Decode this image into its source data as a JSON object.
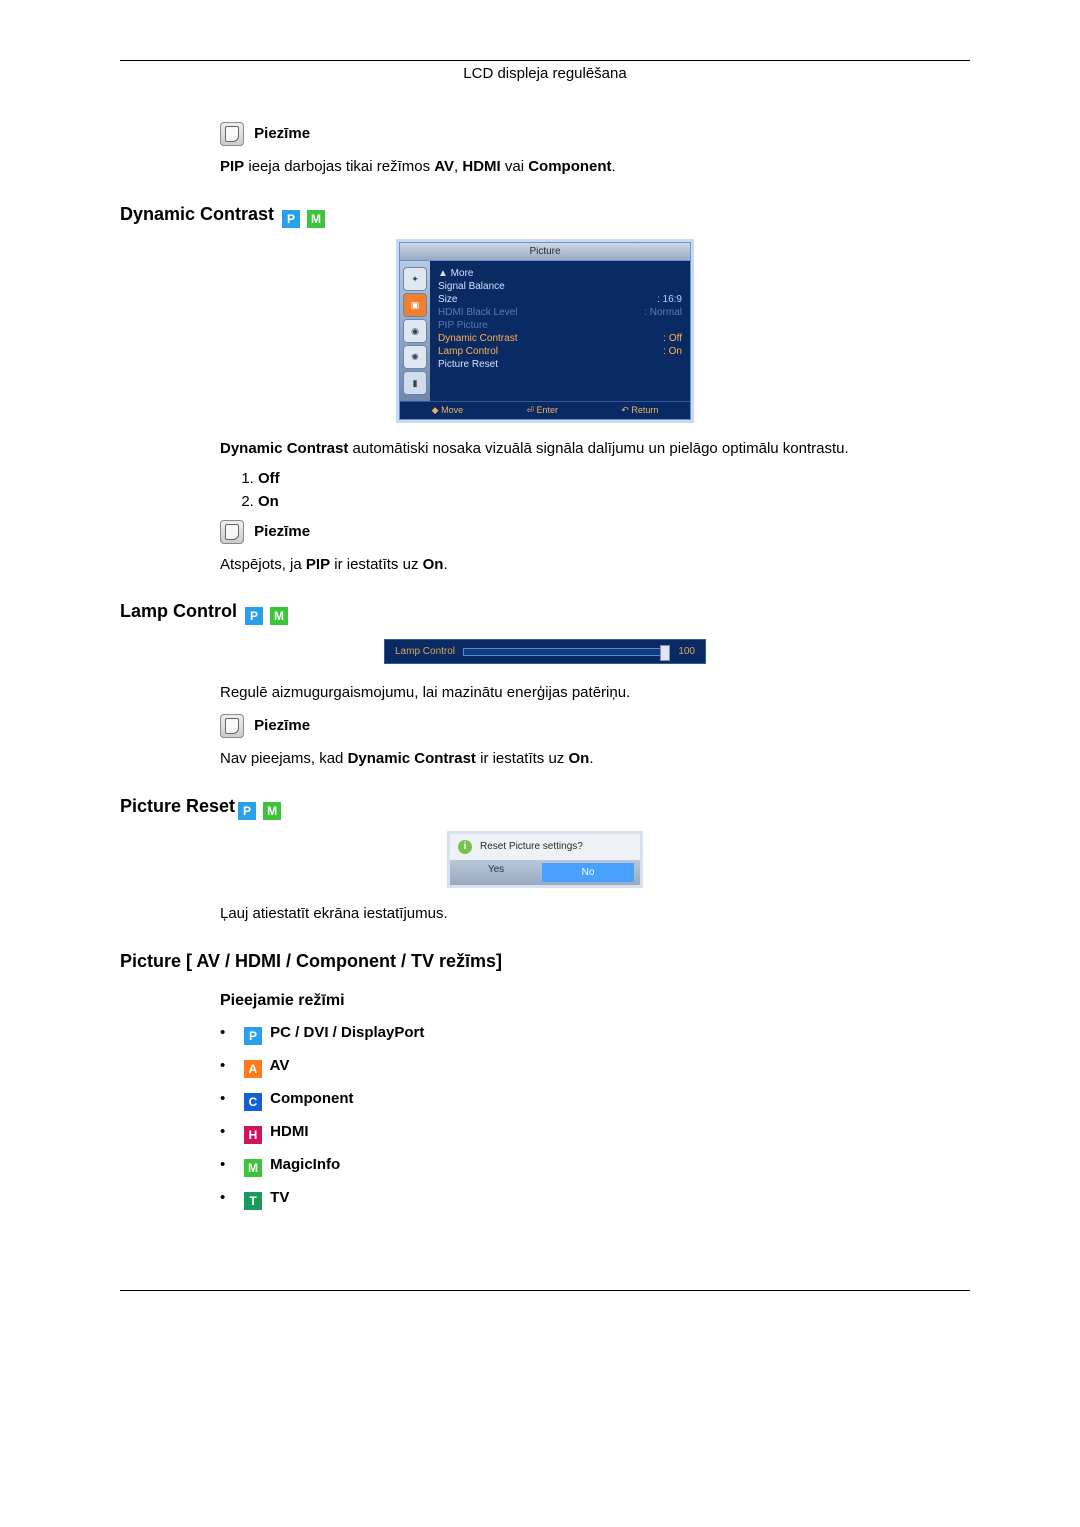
{
  "header": {
    "title": "LCD displeja regulēšana"
  },
  "note_label": "Piezīme",
  "sec1": {
    "note_text_parts": [
      "PIP",
      " ieeja darbojas tikai režīmos ",
      "AV",
      ", ",
      "HDMI",
      " vai ",
      "Component",
      "."
    ]
  },
  "dynamic_contrast": {
    "heading": "Dynamic Contrast ",
    "desc_parts": [
      "Dynamic Contrast",
      " automātiski nosaka vizuālā signāla dalījumu un pielāgo optimālu kontrastu."
    ],
    "options": [
      "Off",
      "On"
    ],
    "note2_parts": [
      "Atspējots, ja ",
      "PIP",
      " ir iestatīts uz ",
      "On",
      "."
    ]
  },
  "osd1": {
    "title": "Picture",
    "rows": [
      {
        "label": "▲ More",
        "value": "",
        "cls": ""
      },
      {
        "label": "Signal Balance",
        "value": "",
        "cls": ""
      },
      {
        "label": "Size",
        "value": ": 16:9",
        "cls": ""
      },
      {
        "label": "HDMI Black Level",
        "value": ": Normal",
        "cls": "dim"
      },
      {
        "label": "PIP Picture",
        "value": "",
        "cls": "dim"
      },
      {
        "label": "Dynamic Contrast",
        "value": "Off",
        "cls": "hi",
        "sel": true
      },
      {
        "label": "Lamp Control",
        "value": "On",
        "cls": "hi",
        "sel": true
      },
      {
        "label": "Picture Reset",
        "value": "",
        "cls": ""
      }
    ],
    "footer": [
      "◆ Move",
      "⏎ Enter",
      "↶ Return"
    ]
  },
  "lamp_control": {
    "heading": "Lamp Control ",
    "desc": "Regulē aizmugurgaismojumu, lai mazinātu enerģijas patēriņu.",
    "note_parts": [
      "Nav pieejams, kad ",
      "Dynamic Contrast",
      " ir iestatīts uz ",
      "On",
      "."
    ]
  },
  "osd2": {
    "label": "Lamp Control",
    "value": "100"
  },
  "picture_reset": {
    "heading": "Picture Reset",
    "desc": "Ļauj atiestatīt ekrāna iestatījumus."
  },
  "osd3": {
    "question": "Reset Picture settings?",
    "yes": "Yes",
    "no": "No"
  },
  "picture_modes": {
    "heading": "Picture [ AV / HDMI / Component / TV režīms]",
    "subheading": "Pieejamie režīmi",
    "items": [
      {
        "badge": "P",
        "label": " PC / DVI / DisplayPort"
      },
      {
        "badge": "A",
        "label": " AV"
      },
      {
        "badge": "C",
        "label": " Component"
      },
      {
        "badge": "H",
        "label": " HDMI"
      },
      {
        "badge": "M",
        "label": " MagicInfo"
      },
      {
        "badge": "T",
        "label": " TV"
      }
    ]
  }
}
